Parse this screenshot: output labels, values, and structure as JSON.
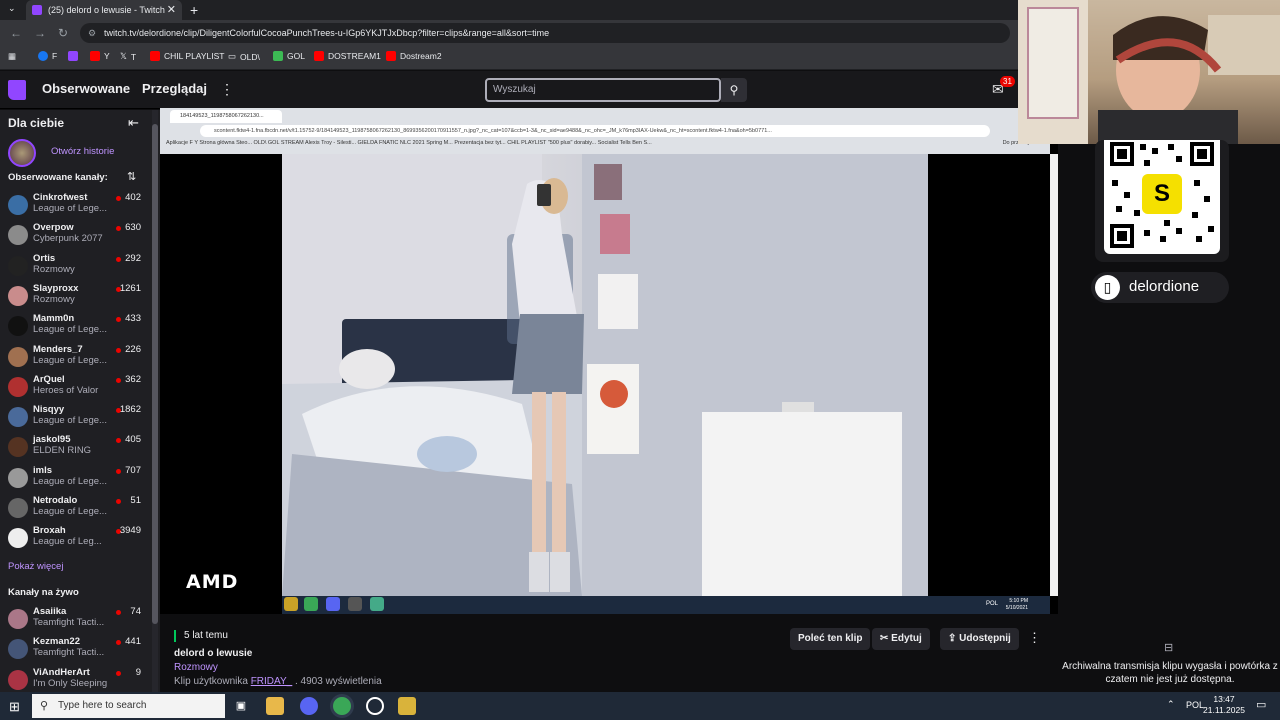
{
  "browser": {
    "tab_title": "(25) delord o lewusie - Twitch",
    "url": "twitch.tv/delordione/clip/DiligentColorfulCocoaPunchTrees-u-IGp6YKJTJxDbcp?filter=clips&range=all&sort=time",
    "bookmarks": [
      {
        "label": "F",
        "color": "#1877f2"
      },
      {
        "label": "",
        "color": "#9146ff"
      },
      {
        "label": "Y",
        "color": "#ff0000"
      },
      {
        "label": "T",
        "color": "#ffffff"
      },
      {
        "label": "CHIL PLAYLIST",
        "color": "#ff0000"
      },
      {
        "label": "OLD\\",
        "color": "#e8eaed"
      },
      {
        "label": "GOL",
        "color": "#3cba54"
      },
      {
        "label": "DOSTREAM1",
        "color": "#ff0000"
      },
      {
        "label": "Dostream2",
        "color": "#ff0000"
      }
    ]
  },
  "twitch": {
    "nav": {
      "following": "Obserwowane",
      "browse": "Przeglądaj"
    },
    "search": {
      "placeholder": "Wyszukaj"
    },
    "notifications": "31"
  },
  "sidebar": {
    "title": "Dla ciebie",
    "story_label": "Otwórz historie",
    "followed_label": "Obserwowane kanały:",
    "live_label": "Kanały na żywo",
    "show_more": "Pokaż więcej",
    "followed": [
      {
        "name": "Cinkrofwest",
        "game": "League of Lege...",
        "viewers": "402",
        "color": "#3a6ea5"
      },
      {
        "name": "Overpow",
        "game": "Cyberpunk 2077",
        "viewers": "630",
        "color": "#8b8b8b"
      },
      {
        "name": "Ortis",
        "game": "Rozmowy",
        "viewers": "292",
        "color": "#222222"
      },
      {
        "name": "Slayproxx",
        "game": "Rozmowy",
        "viewers": "1261",
        "color": "#c98c8c"
      },
      {
        "name": "Mamm0n",
        "game": "League of Lege...",
        "viewers": "433",
        "color": "#111111"
      },
      {
        "name": "Menders_7",
        "game": "League of Lege...",
        "viewers": "226",
        "color": "#a07050"
      },
      {
        "name": "ArQuel",
        "game": "Heroes of Valor",
        "viewers": "362",
        "color": "#b03030"
      },
      {
        "name": "Nisqyy",
        "game": "League of Lege...",
        "viewers": "1862",
        "color": "#4a6a9a"
      },
      {
        "name": "jaskol95",
        "game": "ELDEN RING",
        "viewers": "405",
        "color": "#553322"
      },
      {
        "name": "imls",
        "game": "League of Lege...",
        "viewers": "707",
        "color": "#999999"
      },
      {
        "name": "Netrodalo",
        "game": "League of Lege...",
        "viewers": "51",
        "color": "#666666"
      },
      {
        "name": "Broxah",
        "game": "League of Leg...",
        "viewers": "3949",
        "color": "#eeeeee"
      }
    ],
    "live": [
      {
        "name": "Asaiika",
        "game": "Teamfight Tacti...",
        "viewers": "74",
        "color": "#a78"
      },
      {
        "name": "Kezman22",
        "game": "Teamfight Tacti...",
        "viewers": "441",
        "color": "#457"
      },
      {
        "name": "ViAndHerArt",
        "game": "I'm Only Sleeping",
        "viewers": "9",
        "color": "#a34"
      }
    ]
  },
  "video": {
    "inner_tab": "184149523_1198758067262130...",
    "inner_url": "scontent.fktw4-1.fna.fbcdn.net/v/t1.15752-9/184149523_1198758067262130_869935620017091155​7_n.jpg?_nc_cat=107&ccb=1-3&_nc_sid=ae9488&_nc_ohc=_JM_k76mp3IAX-Uekw&_nc_ht=scontent.fktw4-1.fna&oh=5b0771...",
    "inner_bookmarks": "Aplikacje   F   Y   Strona główna Steo...   OLD\\   GOL   STREAM   Alexis Troy - Silesti...   GIELDA   FNATIC   NLC 2021 Spring M...   Prezentacja bez tyt...   CHIL PLAYLIST   \"500 plus\" dorabiy...   Socialist Tells Ben S...",
    "inner_bookmarks_end": "Do przeczytania",
    "inner_lang": "POL",
    "inner_time": "5:10 PM",
    "inner_date": "5/10/2021",
    "sponsor": "AMD"
  },
  "clip": {
    "age": "5 lat temu",
    "title": "delord o lewusie",
    "category": "Rozmowy",
    "clipped_by_prefix": "Klip użytkownika",
    "clipper": "FRIDAY_",
    "views": ". 4903 wyświetlenia",
    "recommend": "Poleć ten klip",
    "edit": "Edytuj",
    "share": "Udostępnij"
  },
  "right": {
    "handle": "delordione",
    "archive_msg": "Archiwalna transmisja klipu wygasła i powtórka z czatem nie jest już dostępna.",
    "qr_letter": "S"
  },
  "taskbar": {
    "search_placeholder": "Type here to search",
    "lang": "POL",
    "time": "13:47",
    "date": "21.11.2025"
  }
}
